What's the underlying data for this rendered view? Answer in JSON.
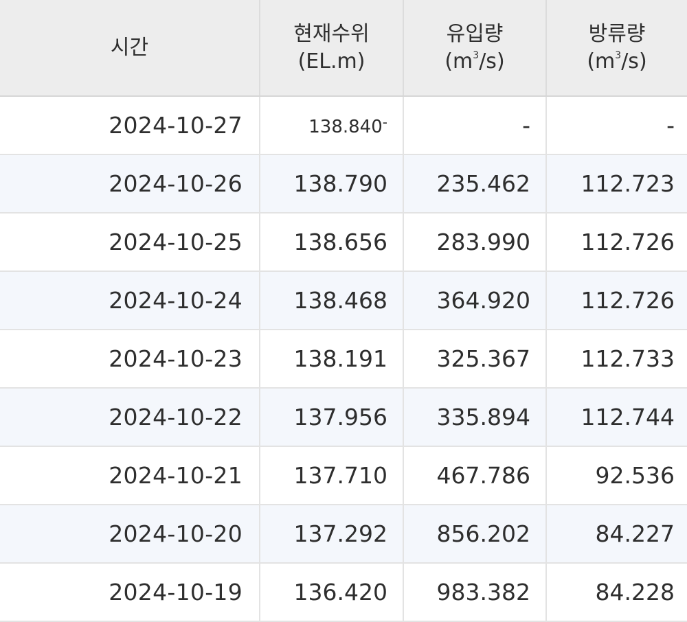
{
  "table": {
    "headers": {
      "time": "시간",
      "level_title": "현재수위",
      "level_unit": "(EL.m)",
      "inflow_title": "유입량",
      "outflow_title": "방류량",
      "flow_unit_open": "(m",
      "flow_unit_exp": "3",
      "flow_unit_close": "/s)"
    },
    "rows": [
      {
        "time": "2024-10-27",
        "level": "138.840",
        "level_dash": "-",
        "inflow": "-",
        "outflow": "-"
      },
      {
        "time": "2024-10-26",
        "level": "138.790",
        "inflow": "235.462",
        "outflow": "112.723"
      },
      {
        "time": "2024-10-25",
        "level": "138.656",
        "inflow": "283.990",
        "outflow": "112.726"
      },
      {
        "time": "2024-10-24",
        "level": "138.468",
        "inflow": "364.920",
        "outflow": "112.726"
      },
      {
        "time": "2024-10-23",
        "level": "138.191",
        "inflow": "325.367",
        "outflow": "112.733"
      },
      {
        "time": "2024-10-22",
        "level": "137.956",
        "inflow": "335.894",
        "outflow": "112.744"
      },
      {
        "time": "2024-10-21",
        "level": "137.710",
        "inflow": "467.786",
        "outflow": "92.536"
      },
      {
        "time": "2024-10-20",
        "level": "137.292",
        "inflow": "856.202",
        "outflow": "84.227"
      },
      {
        "time": "2024-10-19",
        "level": "136.420",
        "inflow": "983.382",
        "outflow": "84.228"
      }
    ]
  },
  "colors": {
    "header_bg": "#ededed",
    "alt_row_bg": "#f4f7fc",
    "border": "#e3e3e3"
  }
}
